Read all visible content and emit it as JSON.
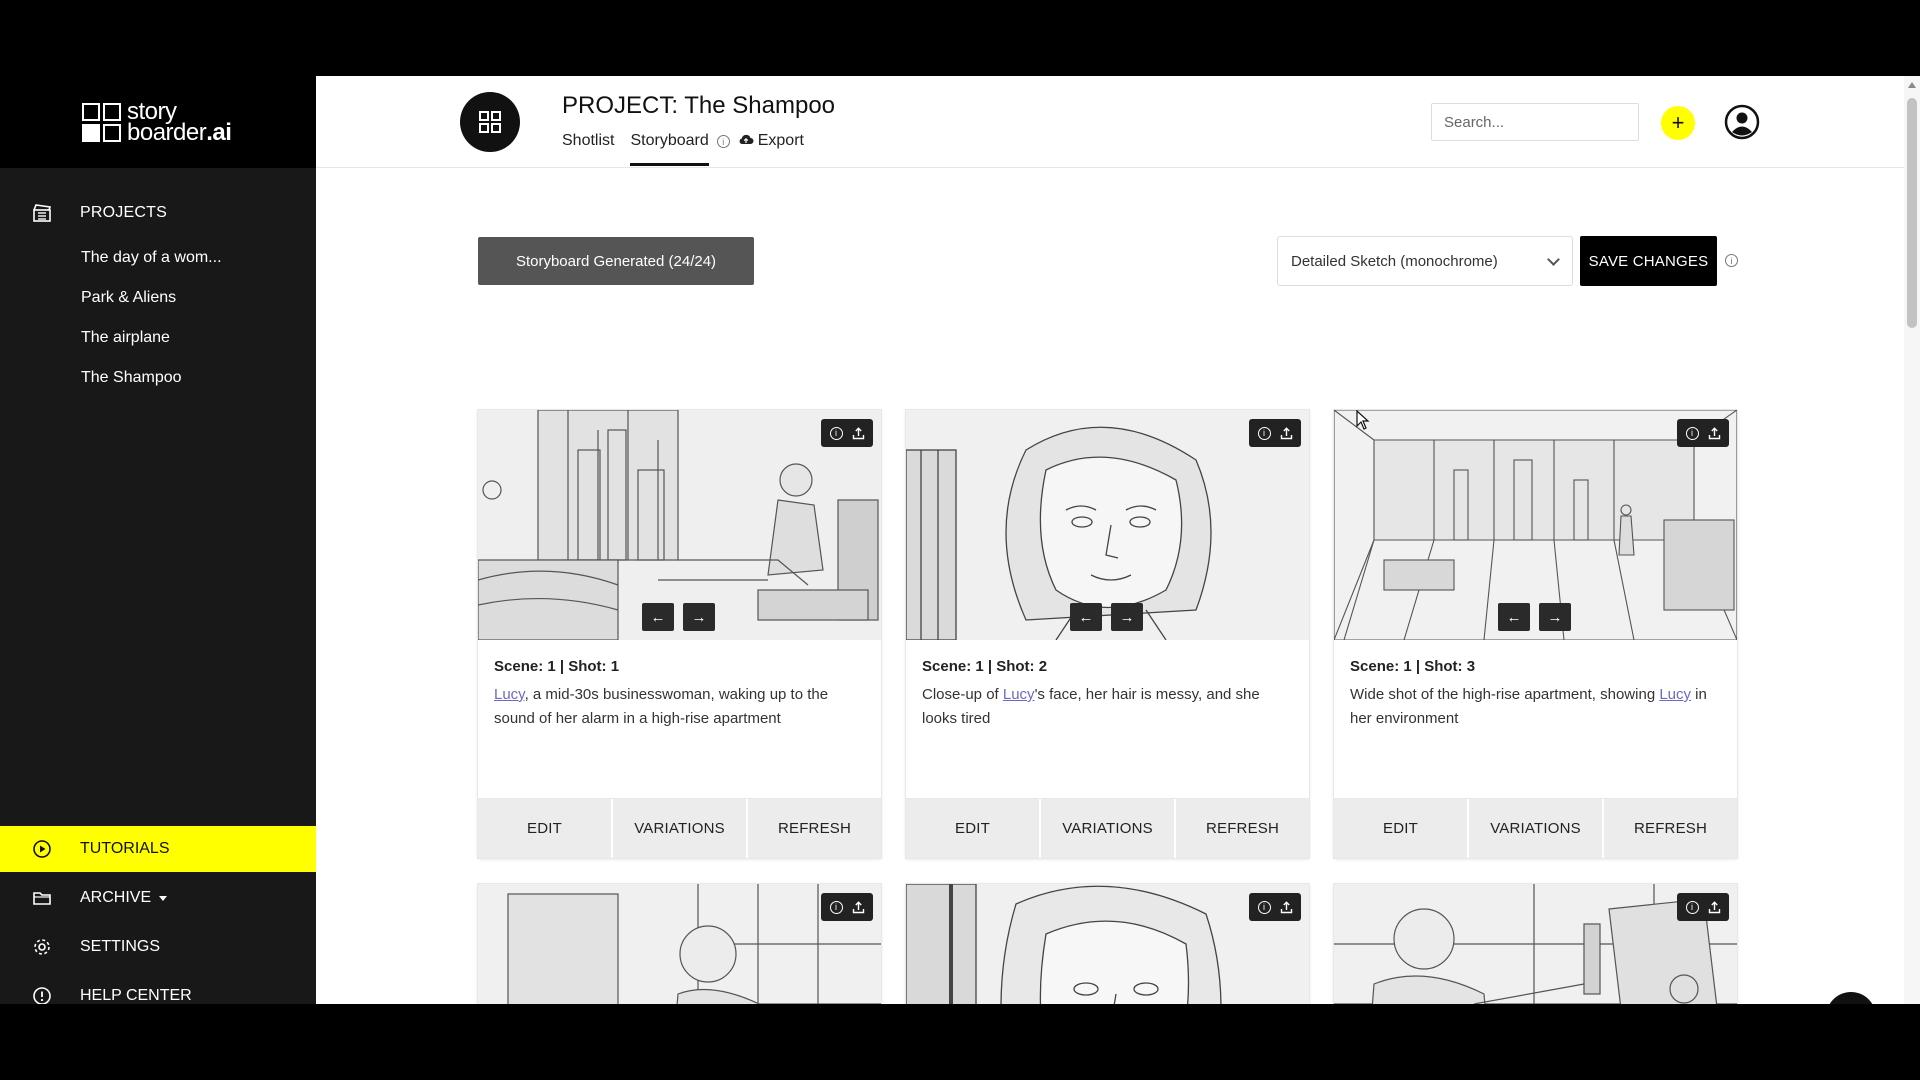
{
  "brand": {
    "word1": "story",
    "word2": "boarder",
    "suffix": ".ai"
  },
  "sidebar": {
    "projects_label": "PROJECTS",
    "projects": [
      "The day of a wom...",
      "Park & Aliens",
      "The airplane",
      "The Shampoo"
    ],
    "bottom": {
      "tutorials": "TUTORIALS",
      "archive": "ARCHIVE",
      "settings": "SETTINGS",
      "help": "HELP CENTER"
    }
  },
  "header": {
    "title": "PROJECT: The Shampoo",
    "tabs": {
      "shotlist": "Shotlist",
      "storyboard": "Storyboard",
      "export": "Export"
    },
    "search_placeholder": "Search...",
    "add_symbol": "+"
  },
  "toolbar": {
    "status": "Storyboard Generated (24/24)",
    "style": "Detailed Sketch (monochrome)",
    "save": "SAVE CHANGES"
  },
  "card_actions": {
    "edit": "EDIT",
    "variations": "VARIATIONS",
    "refresh": "REFRESH"
  },
  "arrows": {
    "prev": "←",
    "next": "→"
  },
  "cards": [
    {
      "label": "Scene: 1 | Shot: 1",
      "link": "Lucy",
      "before": "",
      "after": ", a mid-30s businesswoman, waking up to the sound of her alarm in a high-rise apartment"
    },
    {
      "label": "Scene: 1 | Shot: 2",
      "link": "Lucy",
      "before": "Close-up of ",
      "after": "'s face, her hair is messy, and she looks tired"
    },
    {
      "label": "Scene: 1 | Shot: 3",
      "link": "Lucy",
      "before": "Wide shot of the high-rise apartment, showing ",
      "after": " in her environment"
    }
  ],
  "colors": {
    "accent": "#ffff00",
    "sidebar": "#181818",
    "link": "#6b69c4",
    "status_bg": "#555555"
  }
}
